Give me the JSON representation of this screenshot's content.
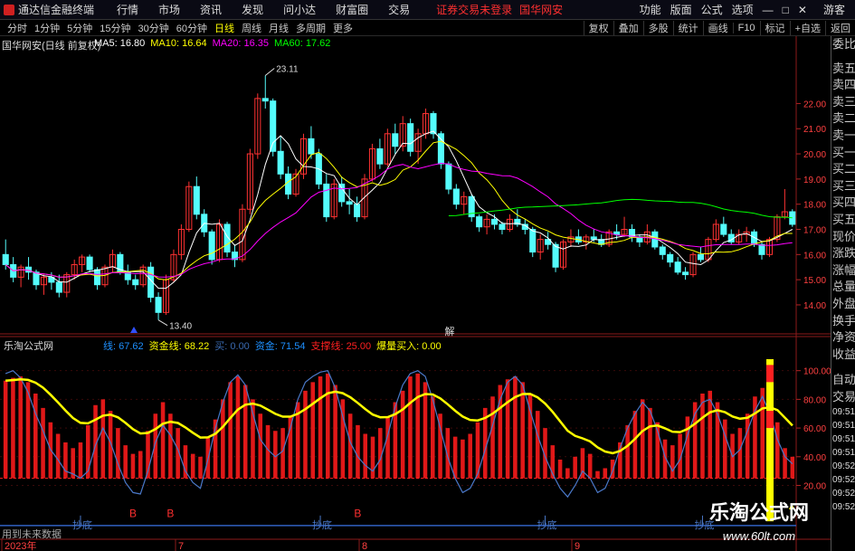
{
  "app": {
    "title": "通达信金融终端",
    "menu": [
      "行情",
      "市场",
      "资讯",
      "发现",
      "问小达",
      "财富圈",
      "交易"
    ],
    "warning": "证券交易未登录",
    "stock_name_top": "国华网安",
    "right_menu": [
      "功能",
      "版面",
      "公式",
      "选项"
    ],
    "right_icons": [
      "minimize-icon",
      "restore-icon",
      "close-icon"
    ],
    "guest": "游客"
  },
  "periods": {
    "items": [
      "分时",
      "1分钟",
      "5分钟",
      "15分钟",
      "30分钟",
      "60分钟",
      "日线",
      "周线",
      "月线",
      "多周期",
      "更多"
    ],
    "selected": "日线"
  },
  "toolbar": [
    "复权",
    "叠加",
    "多股",
    "统计",
    "画线",
    "F10",
    "标记",
    "+自选",
    "返回"
  ],
  "main_panel": {
    "title": "国华网安(日线 前复权)",
    "ma": [
      {
        "label": "MA5: 16.80",
        "color": "#ffffff"
      },
      {
        "label": "MA10: 16.64",
        "color": "#ffff00"
      },
      {
        "label": "MA20: 16.35",
        "color": "#ff00ff"
      },
      {
        "label": "MA60: 17.62",
        "color": "#00ff00"
      }
    ],
    "high_label": "23.11",
    "low_label": "13.40",
    "mark": "解"
  },
  "sub_panel": {
    "title": "乐淘公式网",
    "values": [
      {
        "label": "线: 67.62",
        "color": "#1e90ff"
      },
      {
        "label": "资金线: 68.22",
        "color": "#ffff00"
      },
      {
        "label": "买: 0.00",
        "color": "#3a6ab0"
      },
      {
        "label": "资金: 71.54",
        "color": "#1e90ff"
      },
      {
        "label": "支撑线: 25.00",
        "color": "#ff2020"
      },
      {
        "label": "爆量买入: 0.00",
        "color": "#ffff00"
      }
    ],
    "b_label": "B",
    "chaodi_label": "抄底"
  },
  "bottom": {
    "note": "用到未来数据",
    "dates": [
      "2023年",
      "7",
      "8",
      "9"
    ]
  },
  "side_labels": [
    "委比",
    "卖五",
    "卖四",
    "卖三",
    "卖二",
    "卖一",
    "买一",
    "买二",
    "买三",
    "买四",
    "买五",
    "现价",
    "涨跌",
    "涨幅",
    "总量",
    "外盘",
    "换手",
    "净资",
    "收益"
  ],
  "side_bottom": {
    "title": "自动",
    "sub": "交易",
    "times": [
      "09:51",
      "09:51",
      "09:51",
      "09:51",
      "09:52",
      "09:52",
      "09:52",
      "09:52"
    ]
  },
  "watermark": {
    "name": "乐淘公式网",
    "url": "www.60lt.com"
  },
  "chart_data": [
    {
      "type": "candlestick",
      "title": "国华网安(日线 前复权)",
      "y_ticks": [
        14.0,
        15.0,
        16.0,
        17.0,
        18.0,
        19.0,
        20.0,
        21.0,
        22.0
      ],
      "ylim": [
        13.1,
        24.1
      ],
      "ohlc": [
        [
          16.0,
          16.6,
          15.4,
          15.6
        ],
        [
          15.6,
          15.9,
          14.9,
          15.1
        ],
        [
          15.1,
          15.6,
          14.7,
          15.5
        ],
        [
          15.5,
          15.9,
          15.0,
          15.3
        ],
        [
          15.3,
          15.4,
          14.6,
          14.8
        ],
        [
          14.8,
          15.2,
          14.4,
          15.1
        ],
        [
          15.1,
          15.3,
          14.6,
          14.9
        ],
        [
          14.9,
          15.2,
          14.3,
          14.5
        ],
        [
          14.5,
          15.3,
          14.3,
          15.2
        ],
        [
          15.2,
          15.8,
          15.0,
          15.6
        ],
        [
          15.6,
          16.0,
          15.3,
          15.9
        ],
        [
          15.9,
          16.0,
          15.3,
          15.4
        ],
        [
          15.4,
          15.5,
          14.6,
          14.8
        ],
        [
          14.8,
          15.6,
          14.7,
          15.5
        ],
        [
          15.5,
          16.2,
          15.3,
          16.0
        ],
        [
          16.0,
          16.1,
          15.2,
          15.3
        ],
        [
          15.3,
          15.6,
          14.8,
          15.0
        ],
        [
          15.0,
          15.2,
          14.6,
          14.8
        ],
        [
          14.8,
          15.6,
          14.7,
          15.5
        ],
        [
          15.5,
          15.7,
          14.1,
          14.3
        ],
        [
          14.3,
          14.5,
          13.4,
          13.7
        ],
        [
          13.7,
          15.2,
          13.6,
          15.0
        ],
        [
          15.0,
          16.2,
          14.9,
          16.0
        ],
        [
          16.0,
          17.2,
          15.8,
          17.0
        ],
        [
          17.0,
          18.9,
          16.9,
          18.7
        ],
        [
          18.7,
          19.1,
          17.4,
          17.6
        ],
        [
          17.6,
          17.8,
          16.7,
          16.9
        ],
        [
          16.9,
          17.0,
          15.6,
          15.8
        ],
        [
          15.8,
          17.4,
          15.7,
          17.2
        ],
        [
          17.2,
          17.3,
          15.9,
          16.1
        ],
        [
          16.1,
          16.4,
          15.5,
          15.8
        ],
        [
          15.8,
          18.0,
          15.7,
          17.8
        ],
        [
          17.8,
          20.2,
          17.6,
          20.0
        ],
        [
          20.0,
          22.4,
          19.8,
          22.2
        ],
        [
          22.2,
          23.11,
          21.8,
          22.1
        ],
        [
          22.1,
          22.2,
          19.9,
          20.1
        ],
        [
          20.1,
          20.7,
          19.0,
          19.2
        ],
        [
          19.2,
          19.5,
          18.2,
          18.4
        ],
        [
          18.4,
          19.4,
          18.3,
          19.2
        ],
        [
          19.2,
          20.8,
          19.0,
          20.6
        ],
        [
          20.6,
          21.1,
          19.8,
          20.0
        ],
        [
          20.0,
          20.2,
          18.6,
          18.8
        ],
        [
          18.8,
          19.2,
          17.3,
          17.5
        ],
        [
          17.5,
          19.0,
          17.4,
          18.8
        ],
        [
          18.8,
          19.1,
          17.9,
          18.1
        ],
        [
          18.1,
          18.6,
          17.6,
          18.0
        ],
        [
          18.0,
          18.3,
          17.3,
          17.5
        ],
        [
          17.5,
          19.2,
          17.4,
          19.0
        ],
        [
          19.0,
          20.4,
          18.9,
          20.2
        ],
        [
          20.2,
          20.6,
          19.4,
          19.6
        ],
        [
          19.6,
          21.0,
          19.5,
          20.8
        ],
        [
          20.8,
          21.2,
          20.0,
          20.3
        ],
        [
          20.3,
          21.5,
          20.1,
          21.2
        ],
        [
          21.2,
          21.4,
          19.9,
          20.1
        ],
        [
          20.1,
          21.0,
          19.6,
          20.8
        ],
        [
          20.8,
          21.8,
          20.6,
          21.6
        ],
        [
          21.6,
          21.7,
          20.6,
          20.8
        ],
        [
          20.8,
          20.9,
          19.4,
          19.6
        ],
        [
          19.6,
          19.7,
          18.4,
          18.6
        ],
        [
          18.6,
          18.8,
          17.8,
          18.0
        ],
        [
          18.0,
          18.5,
          17.6,
          18.3
        ],
        [
          18.3,
          18.4,
          17.3,
          17.5
        ],
        [
          17.5,
          17.6,
          16.9,
          17.1
        ],
        [
          17.1,
          17.6,
          16.8,
          17.4
        ],
        [
          17.4,
          17.6,
          17.0,
          17.2
        ],
        [
          17.2,
          17.3,
          16.8,
          17.0
        ],
        [
          17.0,
          17.6,
          16.9,
          17.4
        ],
        [
          17.4,
          17.8,
          17.1,
          17.2
        ],
        [
          17.2,
          17.4,
          16.8,
          17.0
        ],
        [
          17.0,
          17.1,
          15.9,
          16.1
        ],
        [
          16.1,
          16.8,
          15.8,
          16.6
        ],
        [
          16.6,
          16.9,
          16.2,
          16.4
        ],
        [
          16.4,
          16.5,
          15.3,
          15.5
        ],
        [
          15.5,
          16.6,
          15.4,
          16.5
        ],
        [
          16.5,
          17.0,
          16.3,
          16.7
        ],
        [
          16.7,
          17.0,
          16.4,
          16.5
        ],
        [
          16.5,
          16.8,
          16.2,
          16.7
        ],
        [
          16.7,
          17.0,
          16.5,
          16.6
        ],
        [
          16.6,
          16.8,
          16.3,
          16.4
        ],
        [
          16.4,
          17.0,
          16.3,
          16.9
        ],
        [
          16.9,
          17.2,
          16.6,
          16.8
        ],
        [
          16.8,
          17.5,
          16.7,
          17.0
        ],
        [
          17.0,
          17.2,
          16.5,
          16.7
        ],
        [
          16.7,
          16.8,
          16.3,
          16.5
        ],
        [
          16.5,
          17.2,
          16.4,
          16.9
        ],
        [
          16.9,
          17.0,
          16.2,
          16.3
        ],
        [
          16.3,
          16.4,
          15.8,
          16.0
        ],
        [
          16.0,
          16.1,
          15.5,
          15.7
        ],
        [
          15.7,
          15.9,
          15.2,
          15.3
        ],
        [
          15.3,
          15.5,
          15.0,
          15.2
        ],
        [
          15.2,
          16.1,
          15.1,
          16.0
        ],
        [
          16.0,
          16.3,
          15.7,
          15.8
        ],
        [
          15.8,
          16.7,
          15.7,
          16.6
        ],
        [
          16.6,
          17.4,
          16.5,
          17.2
        ],
        [
          17.2,
          17.5,
          16.7,
          16.8
        ],
        [
          16.8,
          17.0,
          16.4,
          16.5
        ],
        [
          16.5,
          17.0,
          16.4,
          16.8
        ],
        [
          16.8,
          17.1,
          16.5,
          16.9
        ],
        [
          16.9,
          17.0,
          16.3,
          16.4
        ],
        [
          16.4,
          16.5,
          15.8,
          16.0
        ],
        [
          16.0,
          16.7,
          15.9,
          16.6
        ],
        [
          16.6,
          17.6,
          16.5,
          17.5
        ],
        [
          17.5,
          18.6,
          17.4,
          17.7
        ],
        [
          17.7,
          17.8,
          17.1,
          17.2
        ]
      ],
      "series": [
        {
          "name": "MA5",
          "color": "#ffffff"
        },
        {
          "name": "MA10",
          "color": "#ffff00"
        },
        {
          "name": "MA20",
          "color": "#ff00ff"
        },
        {
          "name": "MA60",
          "color": "#00ff00"
        }
      ]
    },
    {
      "type": "bar",
      "title": "乐淘公式网",
      "y_ticks": [
        20.0,
        40.0,
        60.0,
        80.0,
        100.0
      ],
      "ylim": [
        -15,
        108
      ],
      "zijin": [
        93,
        95,
        96,
        92,
        84,
        74,
        64,
        56,
        50,
        46,
        50,
        62,
        76,
        80,
        72,
        60,
        48,
        42,
        44,
        58,
        70,
        78,
        70,
        60,
        48,
        42,
        40,
        54,
        66,
        80,
        92,
        96,
        90,
        80,
        70,
        62,
        58,
        60,
        68,
        78,
        86,
        92,
        96,
        98,
        90,
        80,
        70,
        62,
        56,
        54,
        60,
        68,
        78,
        86,
        96,
        98,
        92,
        82,
        70,
        60,
        54,
        52,
        56,
        64,
        74,
        82,
        90,
        94,
        96,
        92,
        84,
        72,
        60,
        48,
        38,
        32,
        40,
        46,
        42,
        30,
        32,
        38,
        50,
        62,
        72,
        80,
        74,
        64,
        52,
        48,
        56,
        68,
        78,
        84,
        86,
        78,
        66,
        56,
        60,
        70,
        82,
        88,
        78,
        64,
        46,
        40
      ],
      "line": [
        98,
        100,
        95,
        85,
        70,
        58,
        45,
        38,
        30,
        28,
        25,
        30,
        48,
        60,
        50,
        35,
        22,
        15,
        14,
        30,
        50,
        62,
        55,
        45,
        30,
        22,
        18,
        38,
        60,
        78,
        92,
        97,
        90,
        70,
        52,
        45,
        40,
        44,
        60,
        80,
        92,
        96,
        99,
        100,
        88,
        68,
        50,
        40,
        34,
        30,
        38,
        55,
        75,
        90,
        98,
        100,
        96,
        80,
        60,
        40,
        25,
        15,
        18,
        28,
        45,
        62,
        80,
        92,
        96,
        90,
        72,
        55,
        40,
        28,
        18,
        12,
        20,
        30,
        25,
        15,
        18,
        30,
        46,
        60,
        70,
        78,
        72,
        58,
        40,
        30,
        38,
        55,
        70,
        78,
        80,
        70,
        55,
        40,
        45,
        58,
        72,
        82,
        70,
        52,
        40,
        35
      ],
      "zhicheng": 25.0
    }
  ]
}
